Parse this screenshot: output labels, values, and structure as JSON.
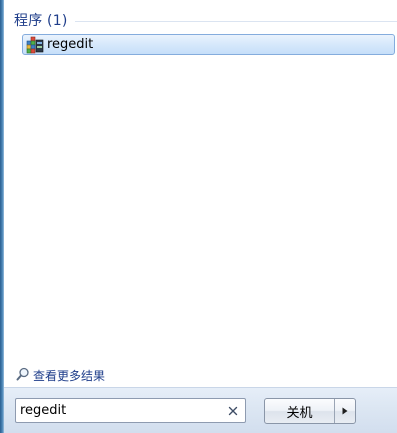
{
  "results": {
    "group_title": "程序 (1)",
    "items": [
      {
        "label": "regedit",
        "icon": "registry-editor-icon"
      }
    ]
  },
  "see_more": {
    "label": "查看更多结果",
    "icon": "search-icon"
  },
  "search": {
    "value": "regedit",
    "clear_icon": "close-icon"
  },
  "power": {
    "shutdown_label": "关机",
    "menu_icon": "triangle-right-icon"
  },
  "colors": {
    "group_title": "#1e3d8a",
    "link": "#1e3d8a",
    "selection_border": "#84acdd",
    "selection_fill": "#d6e8fb",
    "footer_bg": "#dde7f3"
  }
}
